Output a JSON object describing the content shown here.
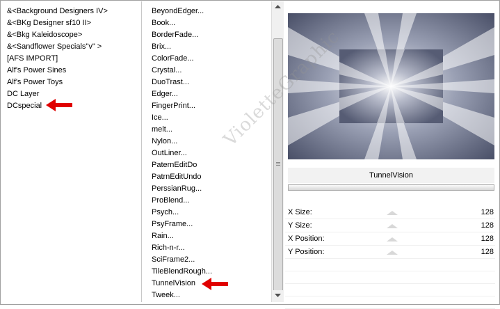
{
  "categories": [
    "&<Background Designers IV>",
    "&<BKg Designer sf10 II>",
    "&<Bkg Kaleidoscope>",
    "&<Sandflower Specials\"v\" >",
    "[AFS IMPORT]",
    "Alf's Power Sines",
    "Alf's Power Toys",
    "DC Layer",
    "DCspecial"
  ],
  "filters": [
    "BeyondEdger...",
    "Book...",
    "BorderFade...",
    "Brix...",
    "ColorFade...",
    "Crystal...",
    "DuoTrast...",
    "Edger...",
    "FingerPrint...",
    "Ice...",
    "melt...",
    "Nylon...",
    "OutLiner...",
    "PaternEditDo",
    "PatrnEditUndo",
    "PerssianRug...",
    "ProBlend...",
    "Psych...",
    "PsyFrame...",
    "Rain...",
    "Rich-n-r...",
    "SciFrame2...",
    "TileBlendRough...",
    "TunnelVision",
    "Tweek..."
  ],
  "selected_filter": "TunnelVision",
  "parameters": [
    {
      "label": "X Size:",
      "value": "128"
    },
    {
      "label": "Y Size:",
      "value": "128"
    },
    {
      "label": "X Position:",
      "value": "128"
    },
    {
      "label": "Y Position:",
      "value": "128"
    }
  ],
  "watermark": "VioletteGraphic",
  "colors": {
    "arrow": "#e00000",
    "preview_dark": "#4a5068",
    "preview_light": "#f4f5f8"
  }
}
